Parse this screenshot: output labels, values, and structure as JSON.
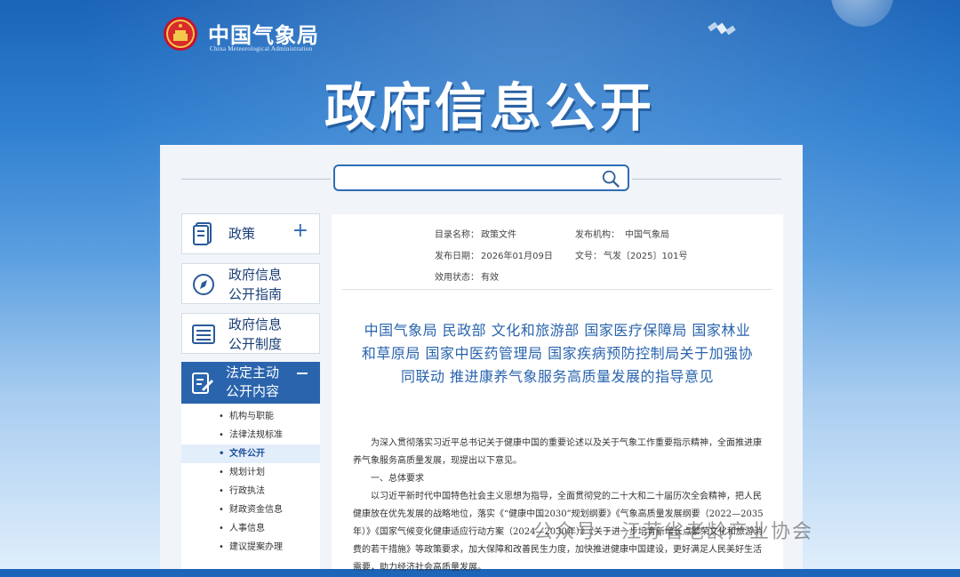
{
  "header": {
    "brand_cn": "中国气象局",
    "brand_en": "China Meteorological Administration",
    "banner_title": "政府信息公开"
  },
  "search": {
    "value": "",
    "placeholder": ""
  },
  "sidebar": {
    "items": [
      {
        "label": "政策",
        "expand": "+"
      },
      {
        "label_line1": "政府信息",
        "label_line2": "公开指南"
      },
      {
        "label_line1": "政府信息",
        "label_line2": "公开制度"
      }
    ],
    "active": {
      "label_line1": "法定主动",
      "label_line2": "公开内容"
    },
    "sub_items": [
      {
        "label": "机构与职能"
      },
      {
        "label": "法律法规标准"
      },
      {
        "label": "文件公开"
      },
      {
        "label": "规划计划"
      },
      {
        "label": "行政执法"
      },
      {
        "label": "财政资金信息"
      },
      {
        "label": "人事信息"
      },
      {
        "label": "建议提案办理"
      }
    ],
    "bullet": "•"
  },
  "document": {
    "meta": {
      "catalog_label": "目录名称：",
      "catalog_value": "政策文件",
      "publisher_label": "发布机构：",
      "publisher_value": "中国气象局",
      "date_label": "发布日期：",
      "date_value": "2026年01月09日",
      "number_label": "文号：",
      "number_value": "气发〔2025〕101号",
      "status_label": "效用状态：",
      "status_value": "有效"
    },
    "title_line1": "中国气象局  民政部  文化和旅游部  国家医疗保障局  国家林业",
    "title_line2": "和草原局  国家中医药管理局  国家疾病预防控制局关于加强协",
    "title_line3": "同联动  推进康养气象服务高质量发展的指导意见",
    "para1": "　　为深入贯彻落实习近平总书记关于健康中国的重要论述以及关于气象工作重要指示精神，全面推进康养气象服务高质量发展，现提出以下意见。",
    "section1": "　　一、总体要求",
    "para2": "　　以习近平新时代中国特色社会主义思想为指导，全面贯彻党的二十大和二十届历次全会精神，把人民健康放在优先发展的战略地位，落实《“健康中国2030”规划纲要》《气象高质量发展纲要（2022—2035年）》《国家气候变化健康适应行动方案（2024—2030年）》《关于进一步培育新增长点繁荣文化和旅游消费的若干措施》等政策要求，加大保障和改善民生力度，加快推进健康中国建设，更好满足人民美好生活需要，助力经济社会高质量发展。"
  },
  "watermark": {
    "text": "公众号 · 江苏省老龄产业协会"
  },
  "colors": {
    "accent": "#2a64ad",
    "title_blue": "#2a64ad",
    "panel_bg": "#f1f4f8"
  }
}
